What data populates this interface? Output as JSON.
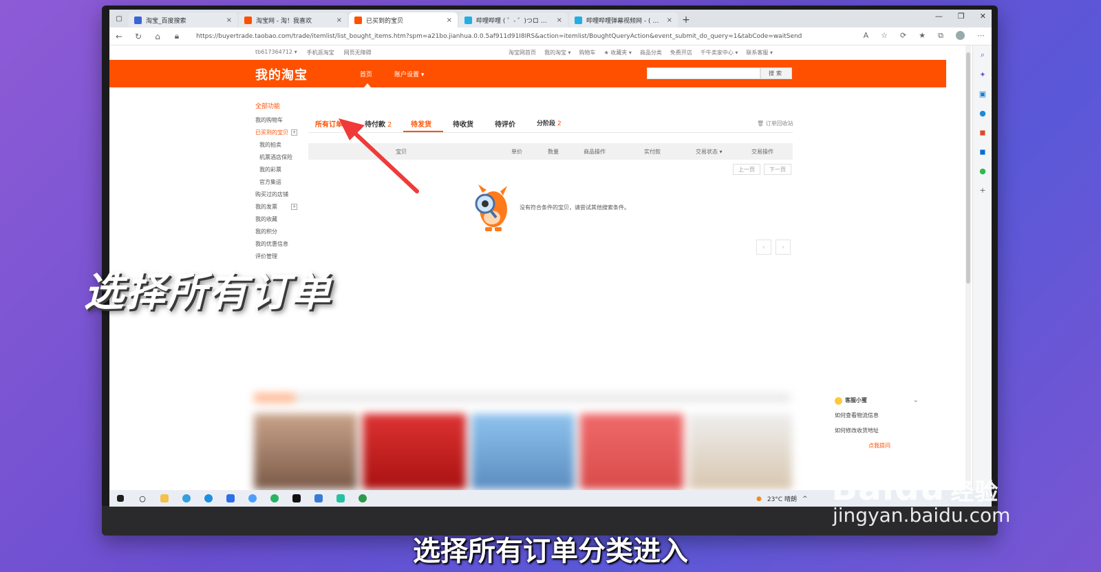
{
  "browser": {
    "tabs": [
      {
        "title": "淘宝_百度搜索",
        "color": "#3a65d8",
        "active": false
      },
      {
        "title": "淘宝网 - 淘！我喜欢",
        "color": "#ff5000",
        "active": false
      },
      {
        "title": "已买到的宝贝",
        "color": "#ff5000",
        "active": true
      },
      {
        "title": "哔哩哔哩 ( ゜- ゜)つロ 干杯~-bili",
        "color": "#23ade5",
        "active": false
      },
      {
        "title": "哔哩哔哩弹幕视频网 - ( ゜- ゜)つ",
        "color": "#23ade5",
        "active": false
      }
    ],
    "close_glyph": "×",
    "new_tab_glyph": "+",
    "url": "https://buyertrade.taobao.com/trade/itemlist/list_bought_items.htm?spm=a21bo.jianhua.0.0.5af911d91I8IRS&action=itemlist/BoughtQueryAction&event_submit_do_query=1&tabCode=waitSend"
  },
  "site_bar": {
    "left": [
      "tb617364712 ▾",
      "手机逛淘宝",
      "网页无障碍"
    ],
    "right": [
      "淘宝网首页",
      "我的淘宝 ▾",
      "购物车",
      "★ 收藏夹 ▾",
      "商品分类",
      "免费开店",
      "千牛卖家中心 ▾",
      "联系客服 ▾"
    ]
  },
  "header": {
    "brand": "我的淘宝",
    "nav_home": "首页",
    "nav_account": "账户设置 ▾",
    "search_button": "搜索",
    "search_placeholder": ""
  },
  "left_menu": {
    "title": "全部功能",
    "items": [
      {
        "label": "我的购物车",
        "type": "normal"
      },
      {
        "label": "已买到的宝贝",
        "type": "active",
        "plus": true
      },
      {
        "label": "我的拍卖",
        "type": "sub"
      },
      {
        "label": "机票酒店保险",
        "type": "sub"
      },
      {
        "label": "我的彩票",
        "type": "sub"
      },
      {
        "label": "官方集运",
        "type": "sub"
      },
      {
        "label": "购买过的店铺",
        "type": "normal"
      },
      {
        "label": "我的发票",
        "type": "normal",
        "plus": true
      },
      {
        "label": "我的收藏",
        "type": "normal"
      },
      {
        "label": "我的积分",
        "type": "normal"
      },
      {
        "label": "我的优惠信息",
        "type": "normal"
      },
      {
        "label": "评价管理",
        "type": "normal"
      }
    ],
    "plus_glyph": "+"
  },
  "order_tabs": {
    "all": "所有订单",
    "pay": "待付款",
    "pay_count": "2",
    "ship": "待发货",
    "receive": "待收货",
    "review": "待评价",
    "stage": "分阶段",
    "stage_count": "2",
    "trash": "订单回收站"
  },
  "table_header": [
    "宝贝",
    "单价",
    "数量",
    "商品操作",
    "实付款",
    "交易状态 ▾",
    "交易操作"
  ],
  "pager": {
    "prev": "上一页",
    "next": "下一页"
  },
  "empty_message": "没有符合条件的宝贝，请尝试其他搜索条件。",
  "customer_service": {
    "title": "客服小蜜",
    "items": [
      "如何查看物流信息",
      "如何修改收货地址"
    ],
    "ask": "点我提问"
  },
  "taskbar": {
    "weather": "23°C 晴朗"
  },
  "overlay": {
    "big_caption": "选择所有订单",
    "subtitle": "选择所有订单分类进入",
    "watermark_logo": "Baidu",
    "watermark_jy": "经验",
    "watermark_url": "jingyan.baidu.com"
  },
  "colors": {
    "taobao_orange": "#ff5000",
    "background": "#6a4fd0"
  }
}
